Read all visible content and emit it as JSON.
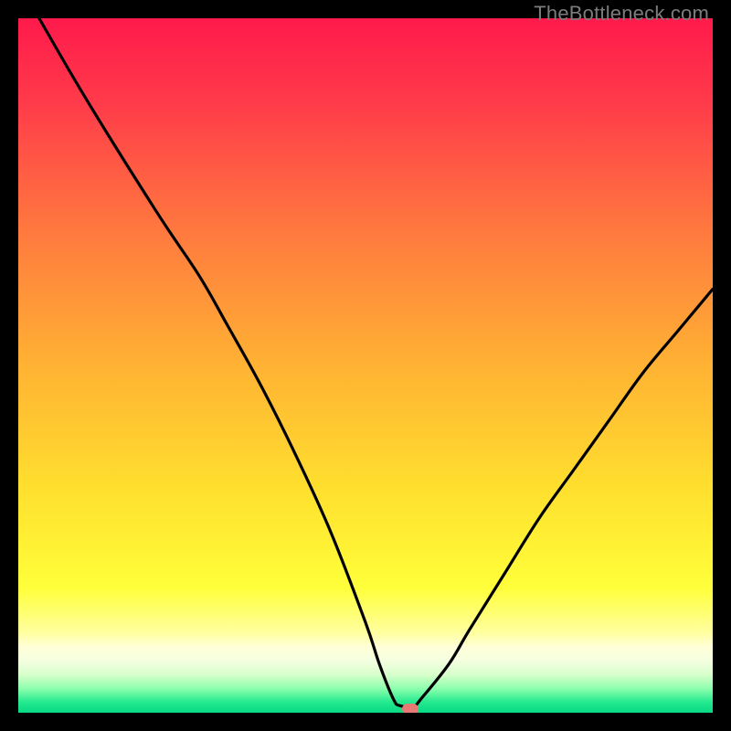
{
  "watermark": "TheBottleneck.com",
  "chart_data": {
    "type": "line",
    "title": "",
    "xlabel": "",
    "ylabel": "",
    "xlim": [
      0,
      100
    ],
    "ylim": [
      0,
      100
    ],
    "x": [
      3,
      10,
      20,
      26,
      30,
      35,
      40,
      45,
      50,
      52,
      54,
      55,
      57,
      58,
      62,
      65,
      70,
      75,
      80,
      85,
      90,
      95,
      100
    ],
    "y": [
      100,
      88,
      72,
      63,
      56,
      47,
      37,
      26,
      13,
      7,
      2,
      1,
      1,
      2,
      7,
      12,
      20,
      28,
      35,
      42,
      49,
      55,
      61
    ],
    "series": [
      {
        "name": "bottleneck-curve",
        "x_key": "x",
        "y_key": "y"
      }
    ],
    "marker": {
      "x": 56.5,
      "y": 0.5,
      "color": "#e77a74"
    },
    "gradient_stops": [
      {
        "offset": 0.0,
        "color": "#ff1a4b"
      },
      {
        "offset": 0.12,
        "color": "#ff3a4a"
      },
      {
        "offset": 0.3,
        "color": "#ff773f"
      },
      {
        "offset": 0.5,
        "color": "#ffb233"
      },
      {
        "offset": 0.68,
        "color": "#ffe02e"
      },
      {
        "offset": 0.82,
        "color": "#ffff3a"
      },
      {
        "offset": 0.885,
        "color": "#ffffa0"
      },
      {
        "offset": 0.905,
        "color": "#ffffd8"
      },
      {
        "offset": 0.925,
        "color": "#f4ffe0"
      },
      {
        "offset": 0.945,
        "color": "#d8ffcc"
      },
      {
        "offset": 0.965,
        "color": "#8dffad"
      },
      {
        "offset": 0.985,
        "color": "#22e98f"
      },
      {
        "offset": 1.0,
        "color": "#08d884"
      }
    ]
  }
}
